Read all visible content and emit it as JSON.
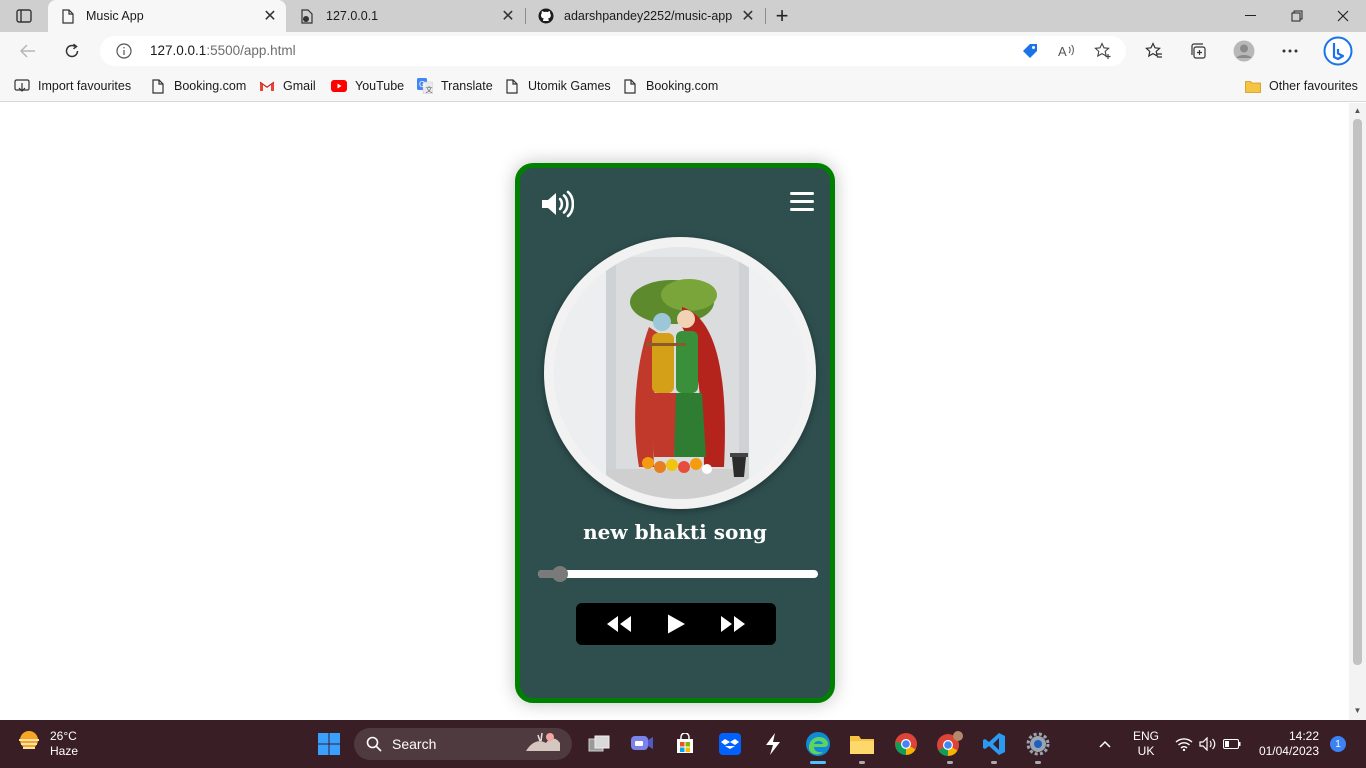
{
  "browser": {
    "tabs": [
      {
        "title": "Music App",
        "active": true
      },
      {
        "title": "127.0.0.1",
        "active": false
      },
      {
        "title": "adarshpandey2252/music-app",
        "active": false
      }
    ],
    "address": {
      "host": "127.0.0.1",
      "path": ":5500/app.html"
    },
    "bookmarks": [
      {
        "label": "Import favourites",
        "icon": "import-icon"
      },
      {
        "label": "Booking.com",
        "icon": "page-icon"
      },
      {
        "label": "Gmail",
        "icon": "gmail-icon"
      },
      {
        "label": "YouTube",
        "icon": "youtube-icon"
      },
      {
        "label": "Translate",
        "icon": "translate-icon"
      },
      {
        "label": "Utomik Games",
        "icon": "page-icon"
      },
      {
        "label": "Booking.com",
        "icon": "page-icon"
      }
    ],
    "other_favourites": "Other favourites"
  },
  "player": {
    "song_title": "new bhakti song",
    "progress": 0.08,
    "colors": {
      "background": "#2f4f4f",
      "border": "#008000",
      "controls": "#000000"
    }
  },
  "taskbar": {
    "weather": {
      "temp": "26°C",
      "condition": "Haze"
    },
    "search_label": "Search",
    "lang": {
      "line1": "ENG",
      "line2": "UK"
    },
    "clock": {
      "time": "14:22",
      "date": "01/04/2023"
    },
    "notifications": "1"
  }
}
